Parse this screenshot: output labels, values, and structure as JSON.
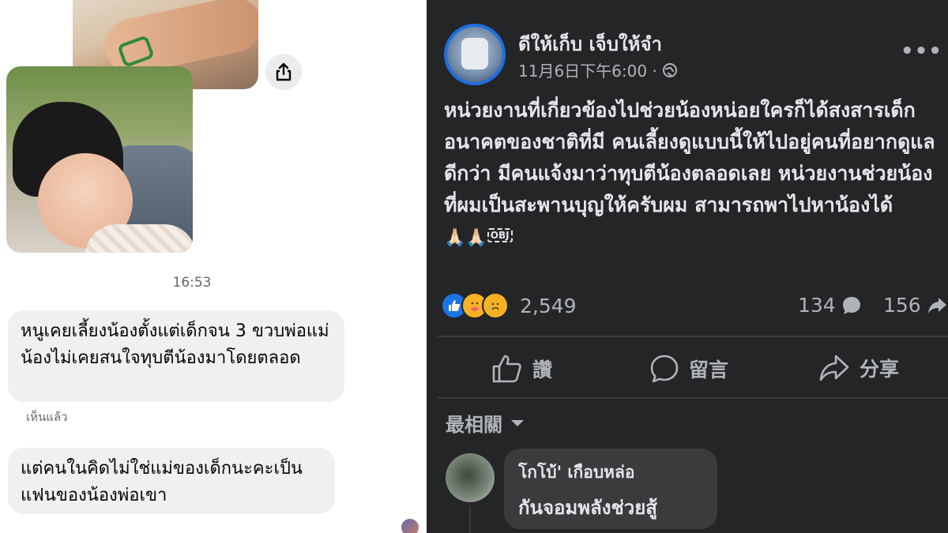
{
  "messenger": {
    "time": "16:53",
    "messages": [
      "หนูเคยเลี้ยงน้องตั้งแต่เด็กจน 3 ขวบพ่อแม่น้องไม่เคยสนใจทุบตีน้องมาโดยตลอด",
      "แต่คนในคิดไม่ใช่แม่ของเด็กนะคะเป็นแฟนของน้องพ่อเขา"
    ],
    "seen_label": "เห็นแล้ว"
  },
  "post": {
    "author": "ดีให้เก็บ เจ็บให้จำ",
    "timestamp": "11月6日下午6:00 ·",
    "text": "หน่วยงานที่เกี่ยวข้องไปช่วยน้องหน่อยใครก็ได้สงสารเด็กอนาคตของชาติที่มี คนเลี้ยงดูแบบนี้ให้ไปอยู่คนที่อยากดูแลดีกว่า มีคนแจ้งมาว่าทุบตีน้องตลอดเลย หน่วยงานช่วยน้องที่ผมเป็นสะพานบุญให้ครับผม สามารถพาไปหาน้องได้",
    "emojis": "🙏🏻🙏🏻",
    "obj_glyph": "OBJ",
    "reaction_count": "2,549",
    "comment_count": "134",
    "share_count": "156",
    "actions": {
      "like": "讚",
      "comment": "留言",
      "share": "分享"
    },
    "sort_label": "最相關",
    "comment": {
      "author": "โกโบ้' เกือบหล่อ",
      "text": "กันจอมพลังช่วยสู้"
    }
  }
}
